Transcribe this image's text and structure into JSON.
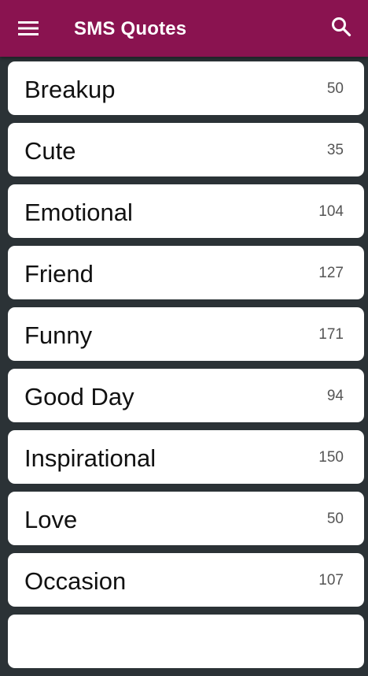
{
  "appbar": {
    "title": "SMS Quotes",
    "menu_icon": "hamburger-menu-icon",
    "search_icon": "search-icon",
    "color": "#8a1350"
  },
  "categories": [
    {
      "label": "Breakup",
      "count": "50"
    },
    {
      "label": "Cute",
      "count": "35"
    },
    {
      "label": "Emotional",
      "count": "104"
    },
    {
      "label": "Friend",
      "count": "127"
    },
    {
      "label": "Funny",
      "count": "171"
    },
    {
      "label": "Good Day",
      "count": "94"
    },
    {
      "label": "Inspirational",
      "count": "150"
    },
    {
      "label": "Love",
      "count": "50"
    },
    {
      "label": "Occasion",
      "count": "107"
    },
    {
      "label": "",
      "count": ""
    }
  ]
}
